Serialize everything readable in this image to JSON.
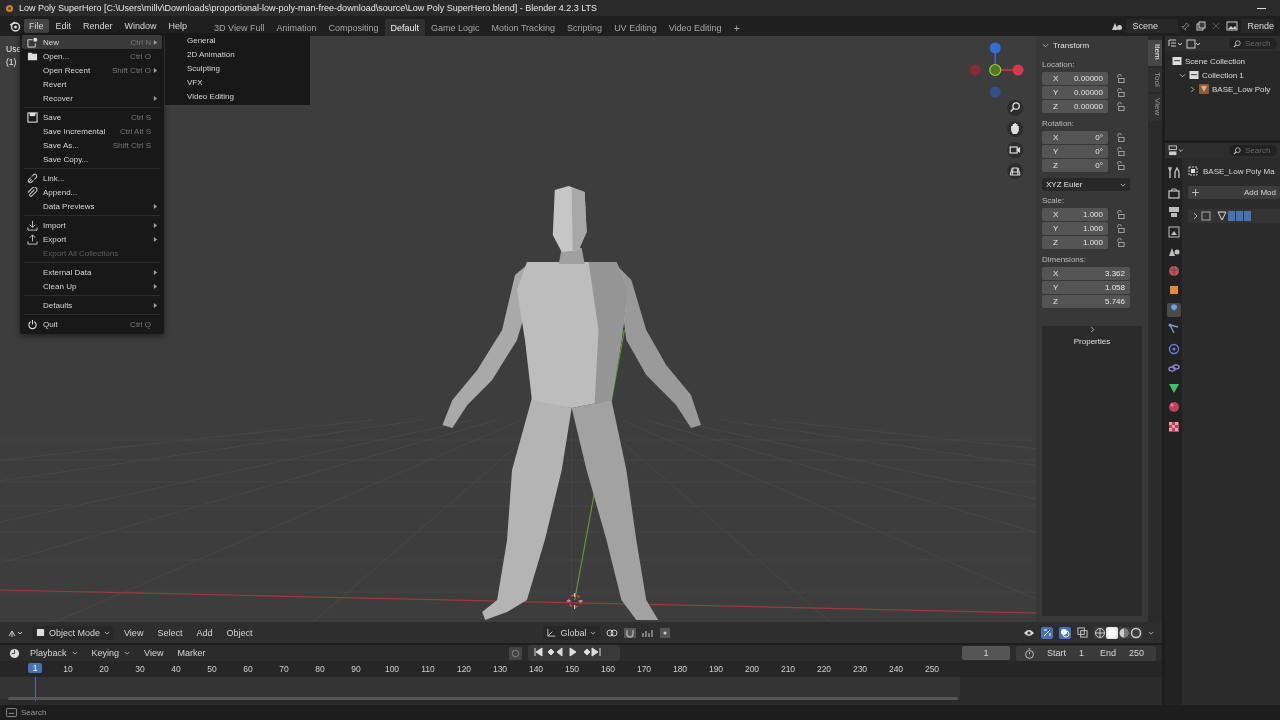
{
  "title_bar": {
    "title": "Low Poly SuperHero [C:\\Users\\millv\\Downloads\\proportional-low-poly-man-free-download\\source\\Low Poly SuperHero.blend] - Blender 4.2.3 LTS"
  },
  "menu_bar": [
    {
      "label": "File",
      "selected": true
    },
    {
      "label": "Edit",
      "selected": false
    },
    {
      "label": "Render",
      "selected": false
    },
    {
      "label": "Window",
      "selected": false
    },
    {
      "label": "Help",
      "selected": false
    }
  ],
  "workspaces": [
    {
      "label": "3D View Full",
      "selected": false
    },
    {
      "label": "Animation",
      "selected": false
    },
    {
      "label": "Compositing",
      "selected": false
    },
    {
      "label": "Default",
      "selected": true
    },
    {
      "label": "Game Logic",
      "selected": false
    },
    {
      "label": "Motion Tracking",
      "selected": false
    },
    {
      "label": "Scripting",
      "selected": false
    },
    {
      "label": "UV Editing",
      "selected": false
    },
    {
      "label": "Video Editing",
      "selected": false
    }
  ],
  "add_workspace": "+",
  "scene": "Scene",
  "view_layer": "Rende",
  "viewport_info": [
    "Use",
    "(1)"
  ],
  "file_menu": [
    [
      {
        "label": "New",
        "shortcut": "Ctrl N",
        "submenu": true,
        "disabled": false,
        "highlighted": true
      },
      {
        "label": "Open...",
        "shortcut": "Ctrl O",
        "submenu": false,
        "disabled": false,
        "highlighted": false
      },
      {
        "label": "Open Recent",
        "shortcut": "Shift Ctrl O",
        "submenu": true,
        "disabled": false,
        "highlighted": false
      },
      {
        "label": "Revert",
        "submenu": false,
        "disabled": false,
        "highlighted": false
      },
      {
        "label": "Recover",
        "submenu": true,
        "disabled": false,
        "highlighted": false
      }
    ],
    [
      {
        "label": "Save",
        "shortcut": "Ctrl S",
        "submenu": false,
        "disabled": false,
        "highlighted": false
      },
      {
        "label": "Save Incremental",
        "shortcut": "Ctrl Alt S",
        "submenu": false,
        "disabled": false,
        "highlighted": false
      },
      {
        "label": "Save As...",
        "shortcut": "Shift Ctrl S",
        "submenu": false,
        "disabled": false,
        "highlighted": false
      },
      {
        "label": "Save Copy...",
        "submenu": false,
        "disabled": false,
        "highlighted": false
      }
    ],
    [
      {
        "label": "Link...",
        "submenu": false,
        "disabled": false,
        "highlighted": false
      },
      {
        "label": "Append...",
        "submenu": false,
        "disabled": false,
        "highlighted": false
      },
      {
        "label": "Data Previews",
        "submenu": true,
        "disabled": false,
        "highlighted": false
      }
    ],
    [
      {
        "label": "Import",
        "submenu": true,
        "disabled": false,
        "highlighted": false
      },
      {
        "label": "Export",
        "submenu": true,
        "disabled": false,
        "highlighted": false
      },
      {
        "label": "Export All Collections",
        "submenu": false,
        "disabled": true,
        "highlighted": false
      }
    ],
    [
      {
        "label": "External Data",
        "submenu": true,
        "disabled": false,
        "highlighted": false
      },
      {
        "label": "Clean Up",
        "submenu": true,
        "disabled": false,
        "highlighted": false
      }
    ],
    [
      {
        "label": "Defaults",
        "submenu": true,
        "disabled": false,
        "highlighted": false
      }
    ],
    [
      {
        "label": "Quit",
        "shortcut": "Ctrl Q",
        "submenu": false,
        "disabled": false,
        "highlighted": false
      }
    ]
  ],
  "new_submenu": [
    "General",
    "2D Animation",
    "Sculpting",
    "VFX",
    "Video Editing"
  ],
  "viewport_header": {
    "mode": "Object Mode",
    "menus": [
      "View",
      "Select",
      "Add",
      "Object"
    ],
    "orientation": "Global",
    "gizmos_on": true,
    "overlays_on": true,
    "shading": [
      {
        "selected": false
      },
      {
        "selected": true
      },
      {
        "selected": false
      },
      {
        "selected": false
      }
    ]
  },
  "sidebar": {
    "tabs": [
      {
        "label": "Item",
        "selected": true
      },
      {
        "label": "Tool",
        "selected": false
      },
      {
        "label": "View",
        "selected": false
      }
    ],
    "title": "Transform",
    "location": {
      "label": "Location:",
      "fields": [
        {
          "axis": "X",
          "value": "0.00000"
        },
        {
          "axis": "Y",
          "value": "0.00000"
        },
        {
          "axis": "Z",
          "value": "0.00000"
        }
      ]
    },
    "rotation": {
      "label": "Rotation:",
      "fields": [
        {
          "axis": "X",
          "value": "0°"
        },
        {
          "axis": "Y",
          "value": "0°"
        },
        {
          "axis": "Z",
          "value": "0°"
        }
      ]
    },
    "rotation_mode": "XYZ Euler",
    "scale": {
      "label": "Scale:",
      "fields": [
        {
          "axis": "X",
          "value": "1.000"
        },
        {
          "axis": "Y",
          "value": "1.000"
        },
        {
          "axis": "Z",
          "value": "1.000"
        }
      ]
    },
    "dimensions": {
      "label": "Dimensions:",
      "fields": [
        {
          "axis": "X",
          "value": "3.362"
        },
        {
          "axis": "Y",
          "value": "1.058"
        },
        {
          "axis": "Z",
          "value": "5.746"
        }
      ]
    },
    "properties": "Properties"
  },
  "outliner": {
    "search_placeholder": "Search",
    "tree": [
      {
        "label": "Scene Collection",
        "children": [
          {
            "label": "Collection 1",
            "expanded": true,
            "children": [
              {
                "label": "BASE_Low Poly",
                "expanded": false
              }
            ]
          }
        ]
      }
    ]
  },
  "properties": {
    "search_placeholder": "Search",
    "object_name": "BASE_Low Poly Ma",
    "add_modifier": "Add Mod",
    "tabs": [
      {
        "selected": false
      },
      {
        "selected": false
      },
      {
        "selected": false
      },
      {
        "selected": false
      },
      {
        "selected": false
      },
      {
        "selected": false
      },
      {
        "selected": false
      },
      {
        "selected": true
      },
      {
        "selected": false
      },
      {
        "selected": false
      },
      {
        "selected": false
      },
      {
        "selected": false
      },
      {
        "selected": false
      },
      {
        "selected": false
      }
    ]
  },
  "timeline": {
    "menus": [
      {
        "label": "Playback",
        "dropdown": true
      },
      {
        "label": "Keying",
        "dropdown": true
      },
      {
        "label": "View",
        "dropdown": false
      },
      {
        "label": "Marker",
        "dropdown": false
      }
    ],
    "current_frame": "1",
    "start_label": "Start",
    "start": "1",
    "end_label": "End",
    "end": "250",
    "playhead": "1",
    "ticks": [
      "10",
      "20",
      "30",
      "40",
      "50",
      "60",
      "70",
      "80",
      "90",
      "100",
      "110",
      "120",
      "130",
      "140",
      "150",
      "160",
      "170",
      "180",
      "190",
      "200",
      "210",
      "220",
      "230",
      "240",
      "250"
    ]
  },
  "status_bar": {
    "search": "Search"
  }
}
